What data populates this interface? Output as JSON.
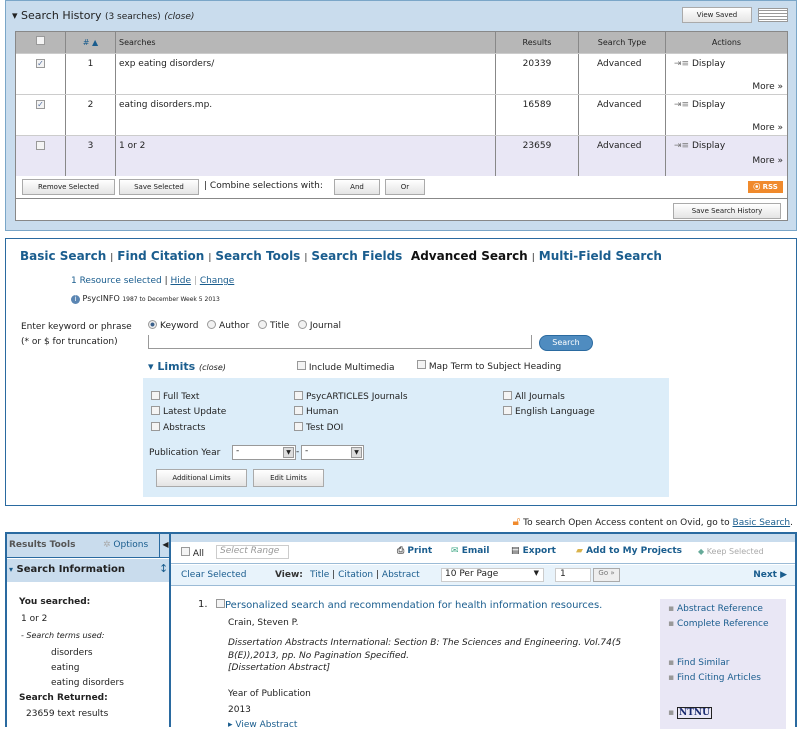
{
  "history": {
    "title": "Search History",
    "count": "(3 searches)",
    "close": "(close)",
    "view_saved": "View Saved",
    "columns": [
      "",
      "# ▲",
      "Searches",
      "Results",
      "Search Type",
      "Actions"
    ],
    "rows": [
      {
        "checked": true,
        "num": "1",
        "query": "exp eating disorders/",
        "results": "20339",
        "type": "Advanced",
        "action": "Display",
        "more": "More »"
      },
      {
        "checked": true,
        "num": "2",
        "query": "eating disorders.mp.",
        "results": "16589",
        "type": "Advanced",
        "action": "Display",
        "more": "More »"
      },
      {
        "checked": false,
        "num": "3",
        "query": "1 or 2",
        "results": "23659",
        "type": "Advanced",
        "action": "Display",
        "more": "More »"
      }
    ],
    "remove_selected": "Remove Selected",
    "save_selected": "Save Selected",
    "combine_label": "Combine selections with:",
    "and": "And",
    "or": "Or",
    "rss": "RSS",
    "save_history": "Save Search History"
  },
  "search": {
    "tabs": [
      "Basic Search",
      "Find Citation",
      "Search Tools",
      "Search Fields",
      "Advanced Search",
      "Multi-Field Search"
    ],
    "resource": "1 Resource selected",
    "hide": "Hide",
    "change": "Change",
    "db_name": "PsycINFO",
    "db_range": "1987 to December Week 5 2013",
    "prompt1": "Enter keyword or phrase",
    "prompt2": "(* or $ for truncation)",
    "modes": [
      "Keyword",
      "Author",
      "Title",
      "Journal"
    ],
    "query": "",
    "search_btn": "Search",
    "limits": "Limits",
    "limits_close": "(close)",
    "include_multimedia": "Include Multimedia",
    "map_term": "Map Term to Subject Heading",
    "limit_items": [
      "Full Text",
      "Latest Update",
      "Abstracts",
      "PsycARTICLES Journals",
      "Human",
      "Test DOI",
      "All Journals",
      "English Language"
    ],
    "pub_year": "Publication Year",
    "year_from": "-",
    "year_to": "-",
    "additional_limits": "Additional Limits",
    "edit_limits": "Edit Limits"
  },
  "open_access": {
    "text": "To search Open Access content on Ovid, go to",
    "link": "Basic Search",
    "end": "."
  },
  "sidebar": {
    "results_tools": "Results Tools",
    "options": "Options",
    "search_info": "Search Information",
    "you_searched": "You searched:",
    "query": "1 or 2",
    "terms_label": "- Search terms used:",
    "terms": [
      "disorders",
      "eating",
      "eating disorders"
    ],
    "returned_label": "Search Returned:",
    "returned": "23659 text results"
  },
  "results": {
    "all": "All",
    "range_placeholder": "Select Range",
    "print": "Print",
    "email": "Email",
    "export": "Export",
    "add_projects": "Add to My Projects",
    "keep_selected": "Keep Selected",
    "clear_selected": "Clear Selected",
    "view": "View:",
    "views": [
      "Title",
      "Citation",
      "Abstract"
    ],
    "per_page": "10 Per Page",
    "page": "1",
    "go": "Go »",
    "next": "Next ▶",
    "item": {
      "num": "1.",
      "title": "Personalized search and recommendation for health information resources.",
      "author": "Crain, Steven P.",
      "source": "Dissertation Abstracts International: Section B: The Sciences and Engineering. Vol.74(5 B(E)),2013, pp. No Pagination Specified.",
      "doc_type": "[Dissertation Abstract]",
      "year_label": "Year of Publication",
      "year": "2013",
      "view_abstract": "View Abstract",
      "links": [
        "Abstract Reference",
        "Complete Reference",
        "Find Similar",
        "Find Citing Articles"
      ],
      "ntnu": "NTNU"
    }
  },
  "colors": {
    "link": "#1a5d8e",
    "panel_border": "#2a6aa0",
    "history_bg": "#c9dced",
    "limits_bg": "#dcedf9",
    "row3_bg": "#e9e7f5"
  }
}
